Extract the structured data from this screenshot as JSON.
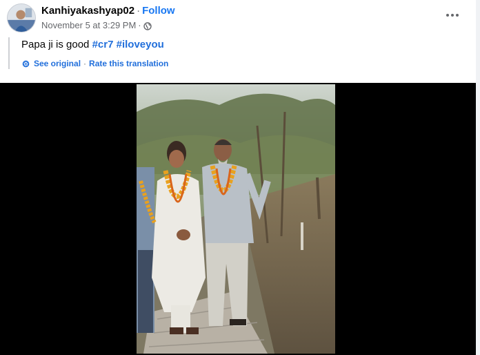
{
  "post": {
    "author": "Kanhiyakashyap02",
    "follow_label": "Follow",
    "separator": "·",
    "timestamp": "November 5 at 3:29 PM",
    "audience_icon": "globe-icon",
    "more_icon": "more-options-icon",
    "caption_text": "Papa ji is good",
    "hashtags": [
      "#cr7",
      "#iloveyou"
    ],
    "see_original": "See original",
    "rate_translation": "Rate this translation",
    "translation_icon": "gear-icon"
  },
  "video": {
    "description": "video-frame"
  },
  "colors": {
    "link": "#216fdb",
    "follow": "#1877f2",
    "secondary_text": "#65676b",
    "video_bg": "#000000"
  }
}
